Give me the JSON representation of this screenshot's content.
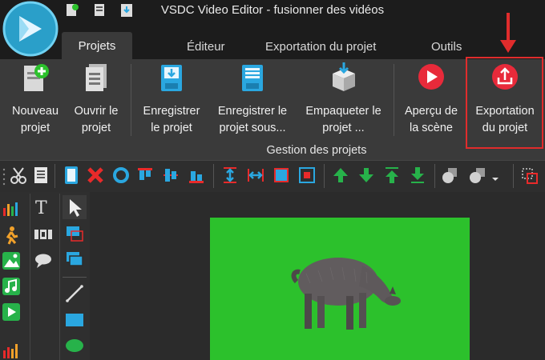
{
  "window": {
    "title": "VSDC Video Editor - fusionner des vidéos"
  },
  "tabs": [
    "Projets",
    "Éditeur",
    "Exportation du projet",
    "Outils"
  ],
  "ribbon": {
    "buttons": [
      {
        "label": "Nouveau\nprojet",
        "icon": "new-project-icon"
      },
      {
        "label": "Ouvrir le\nprojet",
        "icon": "open-project-icon"
      },
      {
        "label": "Enregistrer\nle projet",
        "icon": "save-project-icon"
      },
      {
        "label": "Enregistrer le\nprojet sous...",
        "icon": "save-as-icon"
      },
      {
        "label": "Empaqueter le\nprojet ...",
        "icon": "package-icon"
      },
      {
        "label": "Aperçu de\nla scène",
        "icon": "preview-play-icon"
      },
      {
        "label": "Exportation\ndu projet",
        "icon": "export-project-icon"
      }
    ],
    "group_label": "Gestion des projets"
  },
  "left_tools": {
    "text_tool_label": "T"
  },
  "colors": {
    "accent_red": "#e02c2c",
    "stage_green": "#2cc12c",
    "brand_blue": "#2aa7e0"
  }
}
